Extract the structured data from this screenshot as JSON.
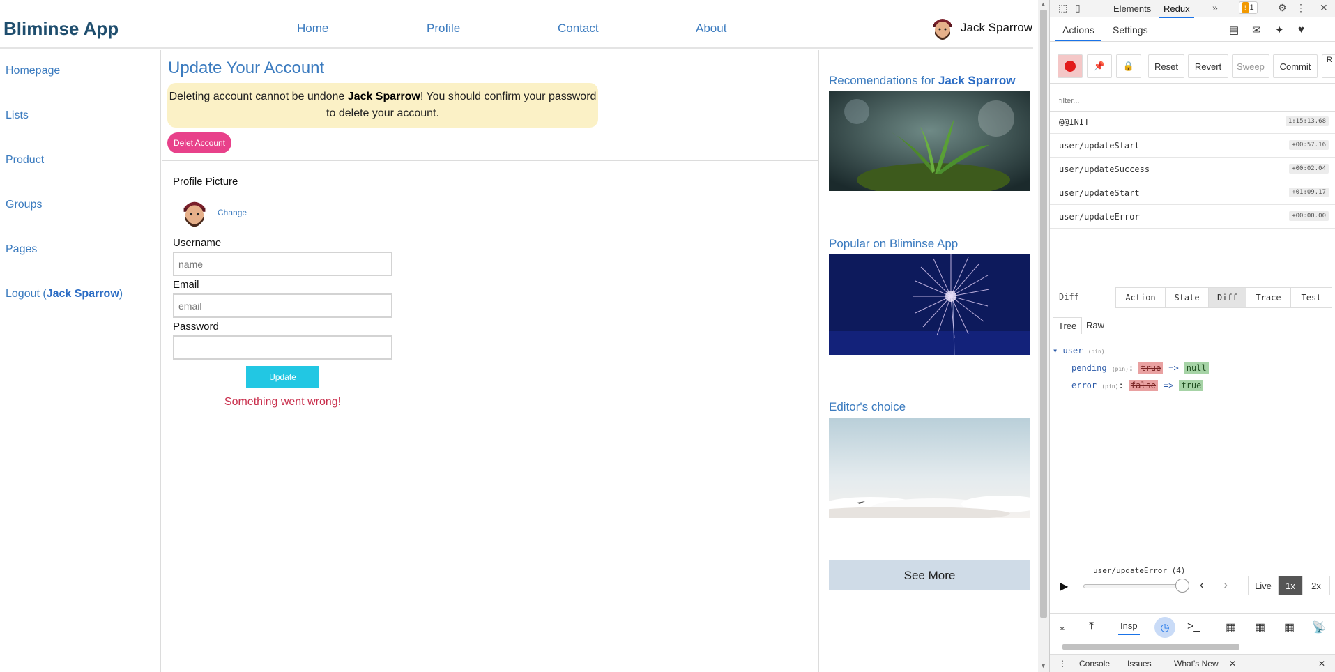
{
  "app": {
    "brand": "Bliminse App",
    "nav": [
      "Home",
      "Profile",
      "Contact",
      "About"
    ],
    "user": {
      "name": "Jack Sparrow"
    }
  },
  "sidebar": {
    "items": [
      {
        "label": "Homepage"
      },
      {
        "label": "Lists"
      },
      {
        "label": "Product"
      },
      {
        "label": "Groups"
      },
      {
        "label": "Pages"
      }
    ],
    "logout": {
      "prefix": "Logout (",
      "user": "Jack Sparrow",
      "suffix": ")"
    }
  },
  "main": {
    "title": "Update Your Account",
    "warning": {
      "pre": "Deleting account cannot be undone ",
      "user": "Jack Sparrow",
      "post": "! You should confirm your password to delete your account."
    },
    "delete_button": "Delet Account",
    "form": {
      "profile_picture_label": "Profile Picture",
      "change_link": "Change",
      "username_label": "Username",
      "username_placeholder": "name",
      "email_label": "Email",
      "email_placeholder": "email",
      "password_label": "Password",
      "update_button": "Update",
      "error_message": "Something went wrong!"
    }
  },
  "right": {
    "rec_prefix": "Recomendations for ",
    "rec_user": "Jack Sparrow",
    "popular": "Popular on Bliminse App",
    "editors": "Editor's choice",
    "see_more": "See More"
  },
  "devtools": {
    "tabs": [
      "Elements",
      "Redux"
    ],
    "active_tab": "Redux",
    "more": "»",
    "warning_count": "1",
    "redux": {
      "subtabs": [
        "Actions",
        "Settings"
      ],
      "toolbar": [
        "Reset",
        "Revert",
        "Sweep",
        "Commit"
      ],
      "cut_label": "R",
      "filter_placeholder": "filter...",
      "actions": [
        {
          "name": "@@INIT",
          "time": "1:15:13.68"
        },
        {
          "name": "user/updateStart",
          "time": "+00:57.16"
        },
        {
          "name": "user/updateSuccess",
          "time": "+00:02.04"
        },
        {
          "name": "user/updateStart",
          "time": "+01:09.17"
        },
        {
          "name": "user/updateError",
          "time": "+00:00.00"
        }
      ],
      "monitor_label": "Diff",
      "monitor_tabs": [
        "Action",
        "State",
        "Diff",
        "Trace",
        "Test"
      ],
      "active_monitor": "Diff",
      "view_tabs": [
        "Tree",
        "Raw"
      ],
      "tree": {
        "root": "user",
        "pin": "(pin)",
        "rows": [
          {
            "key": "pending",
            "old": "true",
            "arrow": "=>",
            "new": "null"
          },
          {
            "key": "error",
            "old": "false",
            "arrow": "=>",
            "new": "true"
          }
        ]
      },
      "slider": {
        "label": "user/updateError (4)",
        "progress": 1.0
      },
      "speeds": [
        "Live",
        "1x",
        "2x"
      ],
      "active_speed": "1x",
      "bottom_tab": "Insp"
    },
    "drawer": [
      "Console",
      "Issues",
      "What's New"
    ]
  },
  "colors": {
    "brand": "#1f4e6e",
    "link": "#3b7bbf",
    "delete": "#e8418a",
    "update": "#22c7e3",
    "error": "#c9304d",
    "warning_bg": "#fbf1c6",
    "see_more_bg": "#cfdbe7"
  }
}
